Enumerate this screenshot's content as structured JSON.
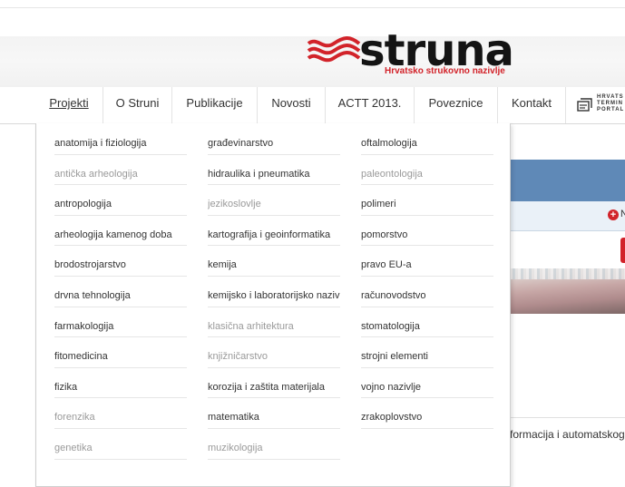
{
  "header": {
    "logo_word": "struna",
    "logo_tagline": "Hrvatsko strukovno nazivlje"
  },
  "nav": {
    "items": [
      {
        "label": "Projekti",
        "active": true
      },
      {
        "label": "O Struni"
      },
      {
        "label": "Publikacije"
      },
      {
        "label": "Novosti"
      },
      {
        "label": "ACTT 2013."
      },
      {
        "label": "Poveznice"
      },
      {
        "label": "Kontakt"
      }
    ],
    "portal_logo_text": "HRVATS\nTERMIN\nPORTAL"
  },
  "dropdown": {
    "columns": [
      [
        {
          "label": "anatomija i fiziologija",
          "muted": false
        },
        {
          "label": "antička arheologija",
          "muted": true
        },
        {
          "label": "antropologija",
          "muted": false
        },
        {
          "label": "arheologija kamenog doba",
          "muted": false
        },
        {
          "label": "brodostrojarstvo",
          "muted": false
        },
        {
          "label": "drvna tehnologija",
          "muted": false
        },
        {
          "label": "farmakologija",
          "muted": false
        },
        {
          "label": "fitomedicina",
          "muted": false
        },
        {
          "label": "fizika",
          "muted": false
        },
        {
          "label": "forenzika",
          "muted": true
        },
        {
          "label": "genetika",
          "muted": true
        }
      ],
      [
        {
          "label": "građevinarstvo",
          "muted": false
        },
        {
          "label": "hidraulika i pneumatika",
          "muted": false
        },
        {
          "label": "jezikoslovlje",
          "muted": true
        },
        {
          "label": "kartografija i geoinformatika",
          "muted": false
        },
        {
          "label": "kemija",
          "muted": false
        },
        {
          "label": "kemijsko i laboratorijsko nazivlje",
          "muted": false
        },
        {
          "label": "klasična arhitektura",
          "muted": true
        },
        {
          "label": "knjižničarstvo",
          "muted": true
        },
        {
          "label": "korozija i zaštita materijala",
          "muted": false
        },
        {
          "label": "matematika",
          "muted": false
        },
        {
          "label": "muzikologija",
          "muted": true
        }
      ],
      [
        {
          "label": "oftalmologija",
          "muted": false
        },
        {
          "label": "paleontologija",
          "muted": true
        },
        {
          "label": "polimeri",
          "muted": false
        },
        {
          "label": "pomorstvo",
          "muted": false
        },
        {
          "label": "pravo EU-a",
          "muted": false
        },
        {
          "label": "računovodstvo",
          "muted": false
        },
        {
          "label": "stomatologija",
          "muted": false
        },
        {
          "label": "strojni elementi",
          "muted": false
        },
        {
          "label": "vojno nazivlje",
          "muted": false
        },
        {
          "label": "zrakoplovstvo",
          "muted": false
        }
      ]
    ]
  },
  "background": {
    "side_letter": "N",
    "bottom_text": "formacija i automatskoga r"
  },
  "colors": {
    "brand_red": "#d2232a",
    "panel_blue": "#5f89b7",
    "muted_text": "#9a9a9a"
  }
}
